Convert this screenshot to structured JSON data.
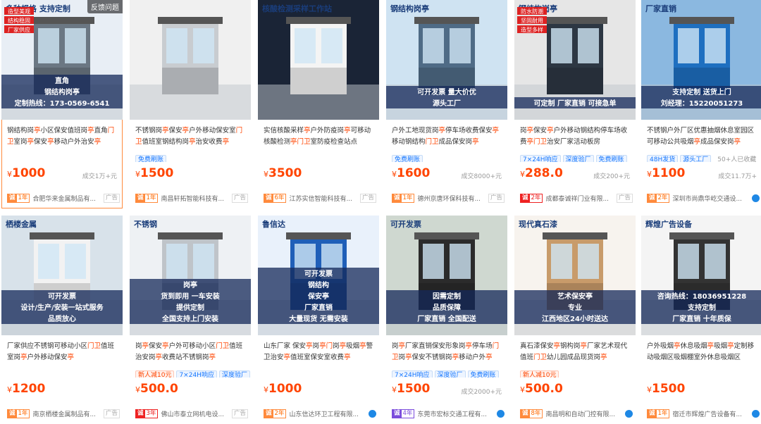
{
  "feedback": "反馈问题",
  "ad_label": "广告",
  "currency": "¥",
  "cards": [
    {
      "title_parts": [
        [
          "钢结构岗",
          0
        ],
        [
          "亭",
          1
        ],
        [
          "小区保安值班岗",
          0
        ],
        [
          "亭",
          1
        ],
        [
          "直角",
          0
        ],
        [
          "门卫",
          1
        ],
        [
          "室岗",
          0
        ],
        [
          "亭",
          1
        ],
        [
          "保安",
          0
        ],
        [
          "亭",
          1
        ],
        [
          "移动户外治安",
          0
        ],
        [
          "亭",
          1
        ]
      ],
      "tags": [],
      "price": "1000",
      "sold": "成交1万+元",
      "years": "1年",
      "year_style": "",
      "shop": "合肥华来金属制品有...",
      "ad": true,
      "chat": false,
      "img": {
        "top": "#e8eef5",
        "body": "#6b7783",
        "texts": [
          "多种规格 支持定制",
          "直角",
          "钢结构岗亭",
          "定制热线：173-0569-6541"
        ],
        "labels": [
          "造型美观",
          "结构稳固",
          "厂家供应"
        ]
      }
    },
    {
      "title_parts": [
        [
          "不锈钢岗",
          0
        ],
        [
          "亭",
          1
        ],
        [
          "保安",
          0
        ],
        [
          "亭",
          1
        ],
        [
          "户外移动保安室",
          0
        ],
        [
          "门",
          1
        ],
        [
          "卫",
          1
        ],
        [
          "值班室钢结构岗",
          0
        ],
        [
          "亭",
          1
        ],
        [
          "治安收费",
          0
        ],
        [
          "亭",
          1
        ]
      ],
      "tags": [
        [
          "免费刷账",
          0
        ]
      ],
      "price": "1500",
      "sold": "",
      "years": "1年",
      "year_style": "",
      "shop": "南昌轩拓智能科技有...",
      "ad": true,
      "chat": false,
      "img": {
        "top": "#f0f0f0",
        "body": "#c8ccd0",
        "texts": [],
        "labels": []
      }
    },
    {
      "title_parts": [
        [
          "实信核酸采样",
          0
        ],
        [
          "亭",
          1
        ],
        [
          "户外防疫岗",
          0
        ],
        [
          "亭",
          1
        ],
        [
          "可移动核酸检测",
          0
        ],
        [
          "亭",
          1
        ],
        [
          "门卫",
          1
        ],
        [
          "室防疫检查站点",
          0
        ]
      ],
      "tags": [],
      "price": "3500",
      "sold": "",
      "years": "6年",
      "year_style": "",
      "shop": "江苏实信智能科技有...",
      "ad": true,
      "chat": false,
      "img": {
        "top": "#1a2436",
        "body": "#f4f4f4",
        "texts": [
          "核酸检测采样工作站"
        ],
        "labels": []
      }
    },
    {
      "title_parts": [
        [
          "户外工地现货岗",
          0
        ],
        [
          "亭",
          1
        ],
        [
          "停车场收费保安",
          0
        ],
        [
          "亭",
          1
        ],
        [
          "移动钢结构",
          0
        ],
        [
          "门卫",
          1
        ],
        [
          "成品保安岗",
          0
        ],
        [
          "亭",
          1
        ]
      ],
      "tags": [
        [
          "免费刷账",
          0
        ]
      ],
      "price": "1600",
      "sold": "成交8000+元",
      "years": "1年",
      "year_style": "",
      "shop": "德州京唐环保科技有...",
      "ad": true,
      "chat": false,
      "img": {
        "top": "#cfe3f2",
        "body": "#4f6b86",
        "texts": [
          "钢结构岗亭",
          "可开发票 量大价优",
          "源头工厂"
        ],
        "labels": []
      }
    },
    {
      "title_parts": [
        [
          "岗",
          0
        ],
        [
          "亭",
          1
        ],
        [
          "保安",
          0
        ],
        [
          "亭",
          1
        ],
        [
          "户外移动钢结构停车场收费",
          0
        ],
        [
          "亭",
          1
        ],
        [
          "门卫",
          1
        ],
        [
          "治安厂家活动板房",
          0
        ]
      ],
      "tags": [
        [
          "7×24H响应",
          0
        ],
        [
          "深度验厂",
          0
        ],
        [
          "免费刷账",
          0
        ]
      ],
      "price": "288.0",
      "sold": "成交200+元",
      "years": "2年",
      "year_style": "redbox",
      "shop": "成都泰诚祥门业有限...",
      "ad": true,
      "chat": false,
      "img": {
        "top": "#e6e6e6",
        "body": "#2d3743",
        "texts": [
          "钢结构岗亭",
          "可定制 厂家直销 可接急单"
        ],
        "labels": [
          "防水防潮",
          "坚固耐用",
          "造型多样"
        ]
      }
    },
    {
      "title_parts": [
        [
          "不锈钢户外厂区优惠抽烟休息室园区可移动公共吸烟",
          0
        ],
        [
          "亭",
          1
        ],
        [
          "成品保安岗",
          0
        ],
        [
          "亭",
          1
        ]
      ],
      "tags": [
        [
          "48H发货",
          0
        ],
        [
          "源头工厂",
          0
        ]
      ],
      "extra": "50+人已收藏",
      "price": "1100",
      "sold": "成交11.7万+",
      "years": "2年",
      "year_style": "",
      "shop": "深圳市尚鼎华屹交通设...",
      "ad": false,
      "chat": true,
      "img": {
        "top": "#8bb8e0",
        "body": "#1e6fc0",
        "texts": [
          "厂家直销",
          "支持定制 送货上门",
          "刘经理：15220051273"
        ],
        "labels": []
      }
    },
    {
      "title_parts": [
        [
          "厂家供应不锈钢可移动小区",
          0
        ],
        [
          "门卫",
          1
        ],
        [
          "值班室岗",
          0
        ],
        [
          "亭",
          1
        ],
        [
          "户外移动保安",
          0
        ],
        [
          "亭",
          1
        ]
      ],
      "tags": [],
      "price": "1200",
      "sold": "",
      "years": "1年",
      "year_style": "",
      "shop": "南京栖楼金属制品有...",
      "ad": true,
      "chat": false,
      "img": {
        "top": "#d8e2ea",
        "body": "#f2f2f2",
        "texts": [
          "栖楼金属",
          "可开发票",
          "设计/生产/安装一站式服务",
          "品质放心"
        ],
        "labels": []
      }
    },
    {
      "title_parts": [
        [
          "岗",
          0
        ],
        [
          "亭",
          1
        ],
        [
          "保安",
          0
        ],
        [
          "亭",
          1
        ],
        [
          "户外可移动小区",
          0
        ],
        [
          "门卫",
          1
        ],
        [
          "值班治安岗",
          0
        ],
        [
          "亭",
          1
        ],
        [
          "收费站不锈钢岗",
          0
        ],
        [
          "亭",
          1
        ]
      ],
      "tags": [
        [
          "新人减10元",
          1
        ],
        [
          "7×24H响应",
          0
        ],
        [
          "深度验厂",
          0
        ]
      ],
      "price": "500.0",
      "sold": "",
      "years": "3年",
      "year_style": "redbox",
      "shop": "佛山市泰立网机电设...",
      "ad": true,
      "chat": false,
      "img": {
        "top": "#eef1f4",
        "body": "#bfc4c9",
        "texts": [
          "不锈钢",
          "岗亭",
          "货到即用 一车安装",
          "提供定制",
          "全国支持上门安装"
        ],
        "labels": []
      }
    },
    {
      "title_parts": [
        [
          "山东厂家 保安",
          0
        ],
        [
          "亭",
          1
        ],
        [
          "岗",
          0
        ],
        [
          "亭",
          1
        ],
        [
          "门",
          1
        ],
        [
          "岗",
          0
        ],
        [
          "亭",
          1
        ],
        [
          "吸烟",
          0
        ],
        [
          "亭",
          1
        ],
        [
          "警卫治安",
          0
        ],
        [
          "亭",
          1
        ],
        [
          "值班室保安室收费",
          0
        ],
        [
          "亭",
          1
        ]
      ],
      "tags": [],
      "price": "1000",
      "sold": "",
      "years": "2年",
      "year_style": "",
      "shop": "山东信达环卫工程有限...",
      "ad": false,
      "chat": true,
      "img": {
        "top": "#e9f1fb",
        "body": "#1f5fb8",
        "texts": [
          "鲁信达",
          "可开发票",
          "钢结构",
          "保安亭",
          "厂家直销",
          "大量现货 无需安装"
        ],
        "labels": []
      }
    },
    {
      "title_parts": [
        [
          "岗",
          0
        ],
        [
          "亭",
          1
        ],
        [
          "厂家直销保安形象岗",
          0
        ],
        [
          "亭",
          1
        ],
        [
          "停车场",
          0
        ],
        [
          "门",
          1
        ],
        [
          "卫",
          1
        ],
        [
          "岗",
          0
        ],
        [
          "亭",
          1
        ],
        [
          "保安不锈钢岗",
          0
        ],
        [
          "亭",
          1
        ],
        [
          "移动户外",
          0
        ],
        [
          "亭",
          1
        ]
      ],
      "tags": [
        [
          "7×24H响应",
          0
        ],
        [
          "深度验厂",
          0
        ],
        [
          "免费刷账",
          0
        ]
      ],
      "price": "1500",
      "sold": "成交2000+元",
      "years": "4年",
      "year_style": "purple",
      "shop": "东莞市宏标交通工程有...",
      "ad": false,
      "chat": true,
      "img": {
        "top": "#cfd8d0",
        "body": "#2b2b2b",
        "texts": [
          "可开发票",
          "因需定制",
          "品质保障",
          "厂家直销 全国配送"
        ],
        "labels": []
      }
    },
    {
      "title_parts": [
        [
          "真石漆保安",
          0
        ],
        [
          "亭",
          1
        ],
        [
          "钢构岗",
          0
        ],
        [
          "亭",
          1
        ],
        [
          "厂家艺术现代值班",
          0
        ],
        [
          "门卫",
          1
        ],
        [
          "幼儿园成品现货岗",
          0
        ],
        [
          "亭",
          1
        ]
      ],
      "tags": [
        [
          "新人减10元",
          1
        ]
      ],
      "price": "500.0",
      "sold": "",
      "years": "8年",
      "year_style": "",
      "shop": "南昌明和自动门控有限...",
      "ad": false,
      "chat": true,
      "img": {
        "top": "#f7f3ee",
        "body": "#c89b6a",
        "texts": [
          "现代真石漆",
          "艺术保安亭",
          "专业",
          "江西地区24小时送达"
        ],
        "labels": []
      }
    },
    {
      "title_parts": [
        [
          "户外吸烟",
          0
        ],
        [
          "亭",
          1
        ],
        [
          "休息吸烟",
          0
        ],
        [
          "亭",
          1
        ],
        [
          "吸烟",
          0
        ],
        [
          "亭",
          1
        ],
        [
          "定制移动吸烟区吸烟棚室外休息吸烟区",
          0
        ]
      ],
      "tags": [],
      "price": "1500",
      "sold": "",
      "years": "1年",
      "year_style": "",
      "shop": "宿迁市辉煌广告设备有...",
      "ad": false,
      "chat": true,
      "img": {
        "top": "#f4f4f4",
        "body": "#333",
        "texts": [
          "辉煌广告设备",
          "咨询热线：18036951228",
          "支持定制",
          "厂家直销 十年质保"
        ],
        "labels": []
      }
    }
  ]
}
